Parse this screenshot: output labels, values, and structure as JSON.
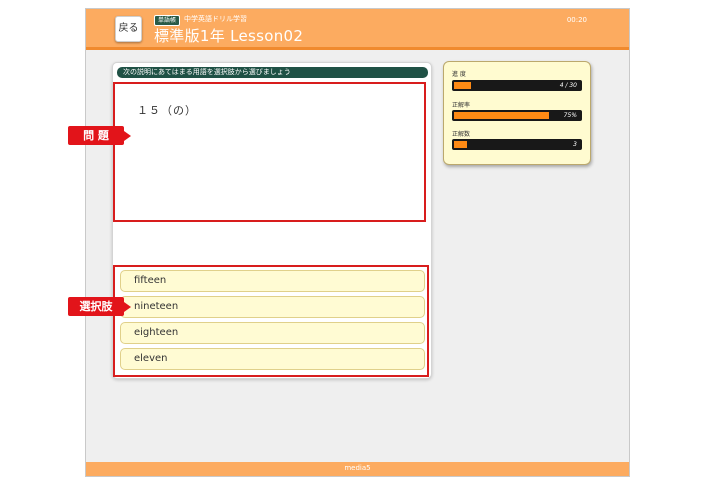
{
  "header": {
    "back_label": "戻る",
    "badge": "単語帳",
    "subtitle": "中学英語ドリル学習",
    "title": "標準版1年 Lesson02",
    "timer": "00:20"
  },
  "footer": {
    "brand": "media5"
  },
  "question": {
    "instruction": "次の説明にあてはまる用語を選択肢から選びましょう",
    "text": "１５（の）"
  },
  "choices": [
    "fifteen",
    "nineteen",
    "eighteen",
    "eleven"
  ],
  "callouts": {
    "question": "問 題",
    "choices": "選択肢"
  },
  "stats": {
    "progress": {
      "label": "進 度",
      "value": "4 / 30",
      "fraction": 0.133
    },
    "accuracy": {
      "label": "正解率",
      "value": "75%",
      "fraction": 0.75
    },
    "correct": {
      "label": "正解数",
      "value": "3",
      "fraction": 0.1
    }
  },
  "colors": {
    "header": "#fcab60",
    "accent_red": "#e2141a",
    "bar_fill": "#ff8a14"
  }
}
